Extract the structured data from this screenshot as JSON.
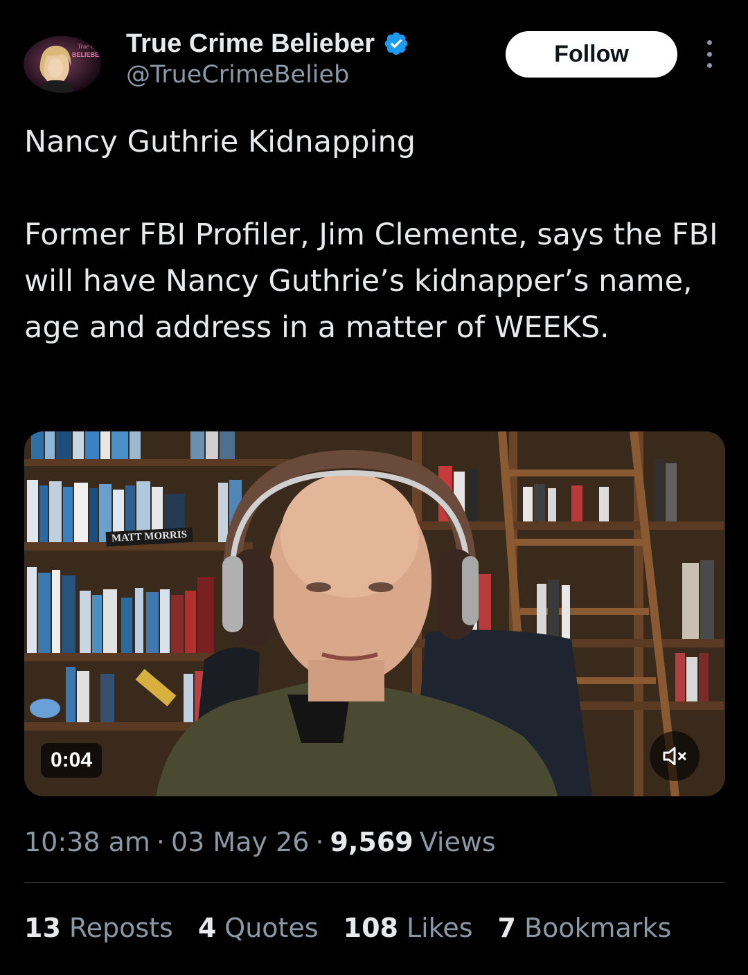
{
  "header": {
    "display_name": "True Crime Belieber",
    "handle": "@TrueCrimeBelieb",
    "verified_icon": "verified-badge-icon",
    "verified_color": "#1d9bf0",
    "follow_label": "Follow",
    "more_icon": "vertical-ellipsis-icon",
    "avatar_logo_text": "True Crime BELIEBER"
  },
  "tweet": {
    "title_line": "Nancy Guthrie Kidnapping",
    "body": "Former FBI Profiler, Jim Clemente, says the FBI will have Nancy Guthrie’s kidnapper’s name, age and address in a matter of WEEKS."
  },
  "video": {
    "timer": "0:04",
    "shelf_label": "MATT MORRIS",
    "mute_icon": "volume-muted-icon"
  },
  "meta": {
    "time": "10:38 am",
    "separator": "·",
    "date": "03 May 26",
    "views_count": "9,569",
    "views_label": "Views"
  },
  "stats": [
    {
      "count": "13",
      "label": "Reposts"
    },
    {
      "count": "4",
      "label": "Quotes"
    },
    {
      "count": "108",
      "label": "Likes"
    },
    {
      "count": "7",
      "label": "Bookmarks"
    }
  ],
  "colors": {
    "background": "#000000",
    "primary_text": "#e7e9ea",
    "secondary_text": "#8b98a5",
    "divider": "#2f3336"
  }
}
